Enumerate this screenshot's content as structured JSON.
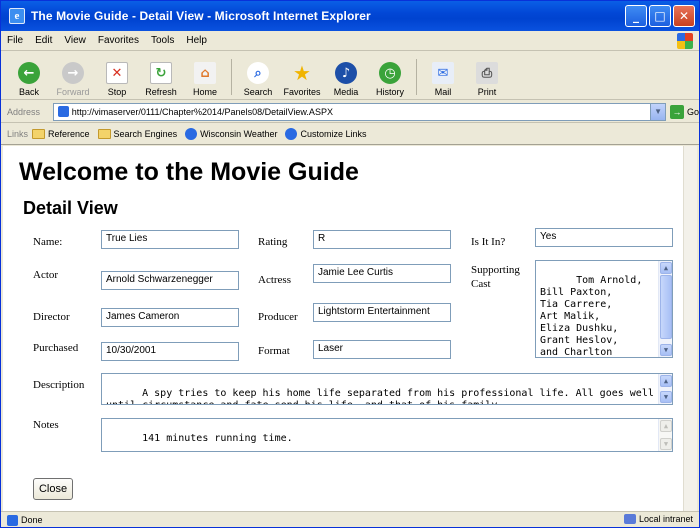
{
  "window": {
    "title": "The Movie Guide - Detail View - Microsoft Internet Explorer",
    "controls": {
      "minimize": "_",
      "maximize": "□",
      "close": "✕"
    }
  },
  "menu": [
    "File",
    "Edit",
    "View",
    "Favorites",
    "Tools",
    "Help"
  ],
  "toolbar": {
    "back": "Back",
    "forward": "Forward",
    "stop": "Stop",
    "refresh": "Refresh",
    "home": "Home",
    "search": "Search",
    "favorites": "Favorites",
    "media": "Media",
    "history": "History",
    "mail": "Mail",
    "print": "Print"
  },
  "address": {
    "label": "Address",
    "url": "http://vimaserver/0111/Chapter%2014/Panels08/DetailView.ASPX",
    "go": "Go"
  },
  "links": {
    "label": "Links",
    "items": [
      "Reference",
      "Search Engines",
      "Wisconsin Weather",
      "Customize Links"
    ]
  },
  "page": {
    "title": "Welcome to the Movie Guide",
    "section": "Detail View"
  },
  "form": {
    "name_label": "Name:",
    "name": "True Lies",
    "rating_label": "Rating",
    "rating": "R",
    "isitin_label": "Is It In?",
    "isitin": "Yes",
    "actor_label": "Actor",
    "actor": "Arnold Schwarzenegger",
    "actress_label": "Actress",
    "actress": "Jamie Lee Curtis",
    "supporting_label_1": "Supporting",
    "supporting_label_2": "Cast",
    "supporting_cast": "Tom Arnold,\nBill Paxton,\nTia Carrere,\nArt Malik,\nEliza Dushku,\nGrant Heslov,\nand Charlton",
    "director_label": "Director",
    "director": "James Cameron",
    "producer_label": "Producer",
    "producer": "Lightstorm Entertainment",
    "purchased_label": "Purchased",
    "purchased": "10/30/2001",
    "format_label": "Format",
    "format": "Laser",
    "description_label": "Description",
    "description": "A spy tries to keep his home life separated from his professional life. All goes well until circumstance and fate send his life, and that of his family,",
    "notes_label": "Notes",
    "notes": "141 minutes running time."
  },
  "buttons": {
    "close": "Close"
  },
  "status": {
    "text": "Done",
    "zone": "Local intranet"
  },
  "colors": {
    "titlebar": "#0a5fe6",
    "chrome": "#ece9d8",
    "field_border": "#7f9db9"
  }
}
